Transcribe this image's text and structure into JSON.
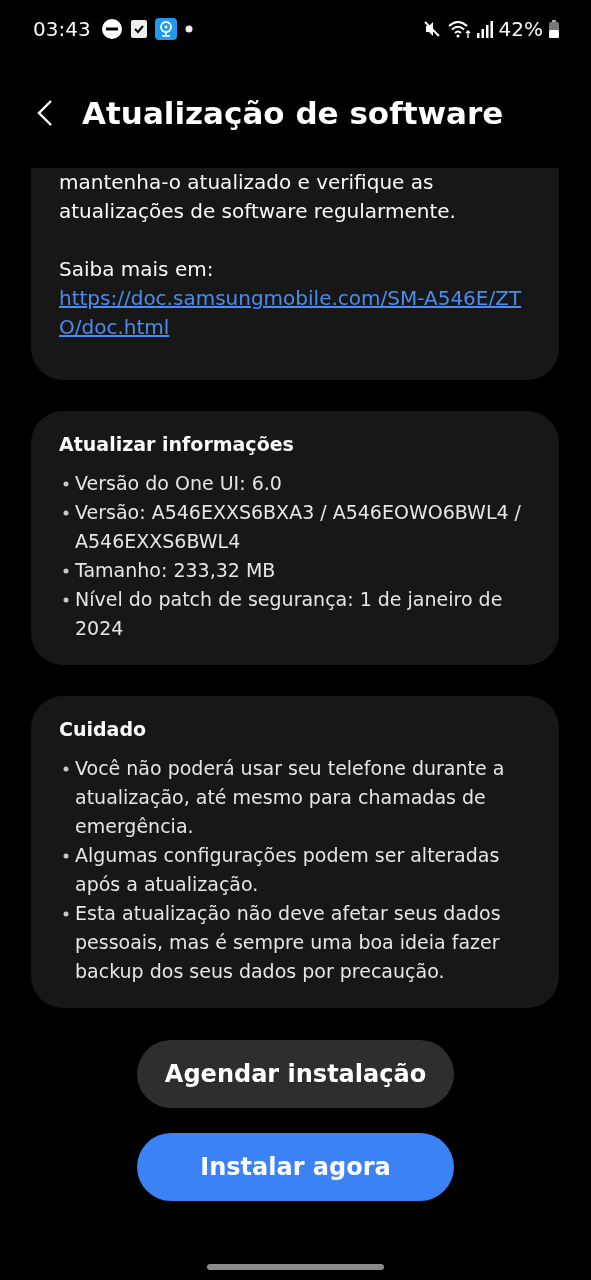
{
  "status_bar": {
    "time": "03:43",
    "battery": "42%"
  },
  "header": {
    "title": "Atualização de software"
  },
  "intro": {
    "text": "mantenha-o atualizado e verifique as atualizações de software regularmente.",
    "more_label": "Saiba mais em:",
    "link": "https://doc.samsungmobile.com/SM-A546E/ZTO/doc.html"
  },
  "sections": [
    {
      "title": "Atualizar informações",
      "items": [
        "Versão do One UI: 6.0",
        "Versão: A546EXXS6BXA3 / A546EOWO6BWL4 / A546EXXS6BWL4",
        "Tamanho: 233,32 MB",
        "Nível do patch de segurança: 1 de janeiro de 2024"
      ]
    },
    {
      "title": "Cuidado",
      "items": [
        "Você não poderá usar seu telefone durante a atualização, até mesmo para chamadas de emergência.",
        "Algumas configurações podem ser alteradas após a atualização.",
        "Esta atualização não deve afetar seus dados pessoais, mas é sempre uma boa ideia fazer backup dos seus dados por precaução."
      ]
    }
  ],
  "buttons": [
    {
      "label": "Agendar instalação",
      "kind": "secondary"
    },
    {
      "label": "Instalar agora",
      "kind": "primary"
    }
  ]
}
